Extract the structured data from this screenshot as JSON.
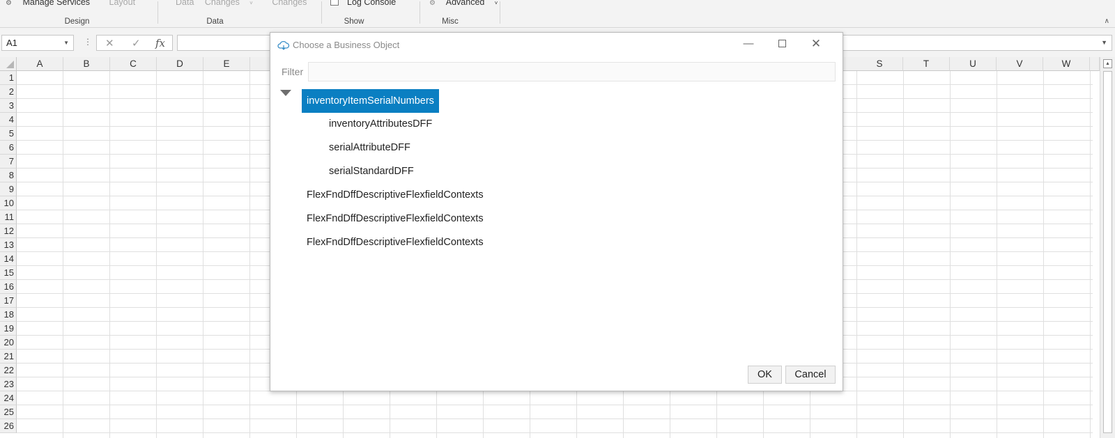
{
  "ribbon": {
    "groups": [
      {
        "label": "Design",
        "items": [
          "Manage Services",
          "Layout"
        ]
      },
      {
        "label": "Data",
        "items": [
          "Data",
          "Changes",
          "Changes"
        ]
      },
      {
        "label": "Show",
        "items": [
          "Log Console"
        ]
      },
      {
        "label": "Misc",
        "items": [
          "Advanced"
        ]
      }
    ]
  },
  "formula_bar": {
    "name_box": "A1",
    "fx": "fx",
    "formula": ""
  },
  "grid": {
    "columns_left": [
      "A",
      "B",
      "C",
      "D",
      "E"
    ],
    "columns_right": [
      "S",
      "T",
      "U",
      "V",
      "W"
    ],
    "rows": [
      "1",
      "2",
      "3",
      "4",
      "5",
      "6",
      "7",
      "8",
      "9",
      "10",
      "11",
      "12",
      "13",
      "14",
      "15",
      "16",
      "17",
      "18",
      "19",
      "20",
      "21",
      "22",
      "23",
      "24",
      "25",
      "26"
    ]
  },
  "dialog": {
    "title": "Choose a Business Object",
    "filter_label": "Filter",
    "filter_value": "",
    "tree": {
      "root": "inventoryItemSerialNumbers",
      "children": [
        "inventoryAttributesDFF",
        "serialAttributeDFF",
        "serialStandardDFF"
      ],
      "siblings": [
        "FlexFndDffDescriptiveFlexfieldContexts",
        "FlexFndDffDescriptiveFlexfieldContexts",
        "FlexFndDffDescriptiveFlexfieldContexts"
      ]
    },
    "ok_label": "OK",
    "cancel_label": "Cancel"
  },
  "colors": {
    "selection": "#0a7fc2",
    "ribbon_bg": "#f3f3f3"
  }
}
